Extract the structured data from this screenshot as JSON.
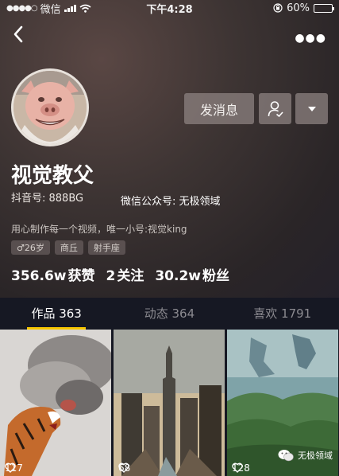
{
  "status_bar": {
    "carrier": "微信",
    "time": "下午4:28",
    "battery": "60%",
    "battery_level": 0.6
  },
  "profile": {
    "name": "视觉教父",
    "douyin_id": "抖音号: 888BG",
    "watermark": "微信公众号: 无极领域",
    "bio": "用心制作每一个视频，唯一小号:视觉king",
    "tags": [
      "♂26岁",
      "商丘",
      "射手座"
    ],
    "stats": [
      {
        "num": "356.6w",
        "label": "获赞"
      },
      {
        "num": "2",
        "label": "关注"
      },
      {
        "num": "30.2w",
        "label": "粉丝"
      }
    ]
  },
  "actions": {
    "message": "发消息"
  },
  "tabs": [
    "作品 363",
    "动态 364",
    "喜欢 1791"
  ],
  "videos": [
    {
      "likes": "117"
    },
    {
      "likes": "68"
    },
    {
      "likes": "128"
    }
  ],
  "wechat_mark": "无极领域",
  "colors": {
    "accent": "#f7c600",
    "background": "#161823"
  }
}
